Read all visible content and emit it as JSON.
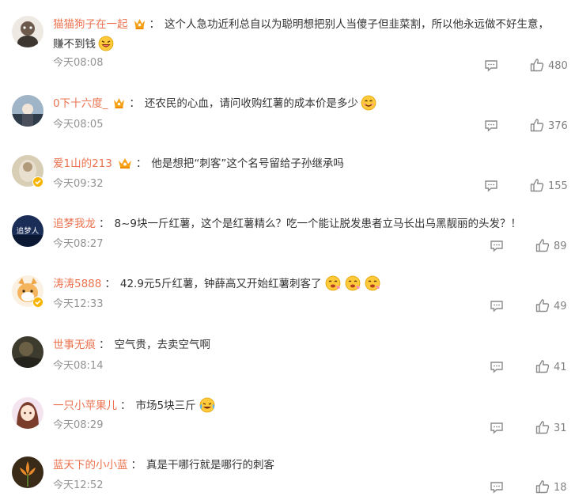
{
  "comments": [
    {
      "user": "猫猫狗子在一起",
      "text": "这个人急功近利总自以为聪明想把别人当傻子但韭菜割，所以他永远做不好生意，",
      "text2": "赚不到钱",
      "time": "今天08:08",
      "likes": "480"
    },
    {
      "user": "0下十六度_",
      "text": "还农民的心血，请问收购红薯的成本价是多少",
      "time": "今天08:05",
      "likes": "376"
    },
    {
      "user": "爱1山的213",
      "text": "他是想把“刺客”这个名号留给子孙继承吗",
      "time": "今天09:32",
      "likes": "155"
    },
    {
      "user": "追梦我龙",
      "text": "8~9块一斤红薯，这个是红薯精么？吃一个能让脱发患者立马长出乌黑靓丽的头发？！",
      "time": "今天08:27",
      "likes": "89",
      "avatar_text": "追梦人"
    },
    {
      "user": "涛涛5888",
      "text": "42.9元5斤红薯，钟薛高又开始红薯刺客了",
      "time": "今天12:33",
      "likes": "49"
    },
    {
      "user": "世事无痕",
      "text": "空气贵，去卖空气啊",
      "time": "今天08:14",
      "likes": "41"
    },
    {
      "user": "一只小苹果儿",
      "text": "市场5块三斤",
      "time": "今天08:29",
      "likes": "31"
    },
    {
      "user": "蓝天下的小小蓝",
      "text": "真是干哪行就是哪行的刺客",
      "time": "今天12:52",
      "likes": "18"
    }
  ],
  "colors": {
    "username": "#eb7350",
    "text": "#333333",
    "meta": "#939393",
    "badge": "#f7b500"
  }
}
